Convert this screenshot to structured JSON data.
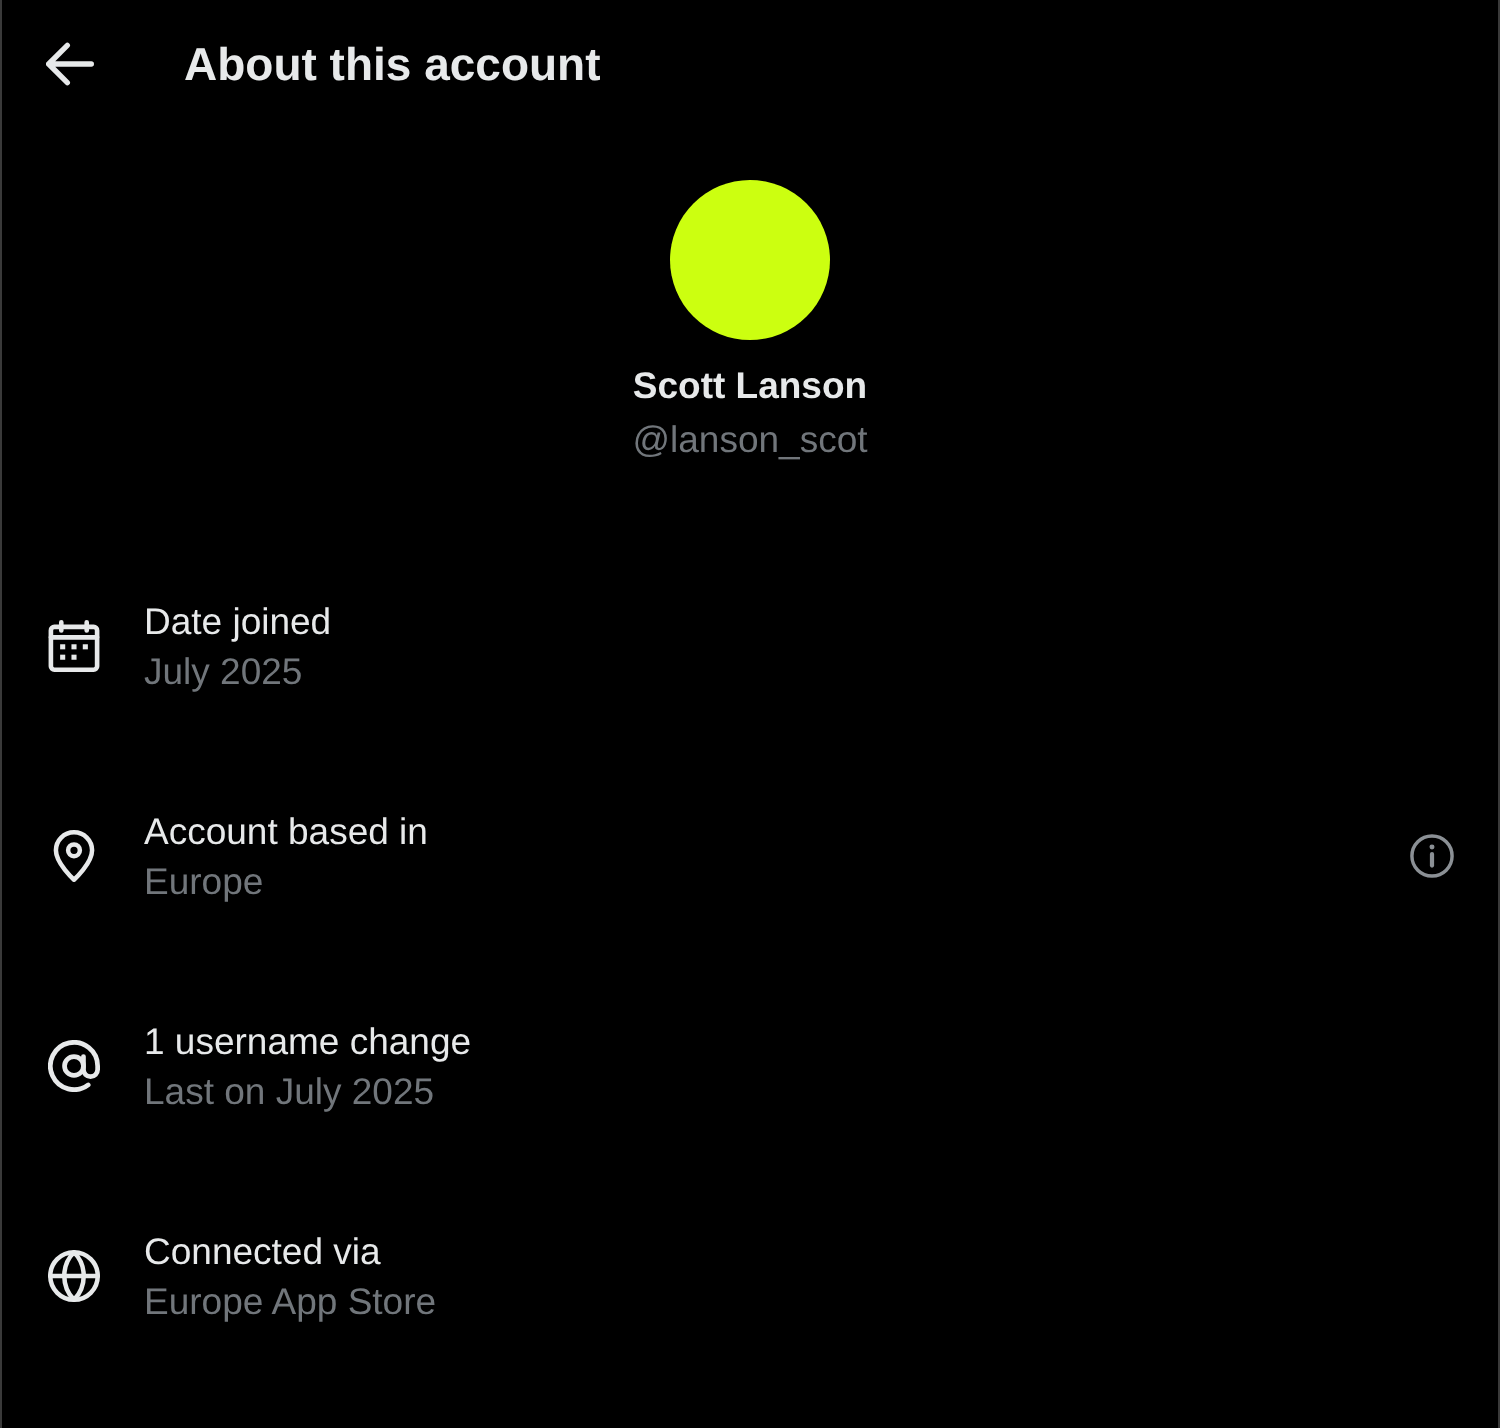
{
  "header": {
    "title": "About this account"
  },
  "profile": {
    "name": "Scott Lanson",
    "handle": "@lanson_scot"
  },
  "details": [
    {
      "kind": "joined",
      "label": "Date joined",
      "value": "July 2025",
      "info_button": false
    },
    {
      "kind": "location",
      "label": "Account based in",
      "value": "Europe",
      "info_button": true
    },
    {
      "kind": "username",
      "label": "1 username change",
      "value": "Last on July 2025",
      "info_button": false
    },
    {
      "kind": "connection",
      "label": "Connected via",
      "value": "Europe App Store",
      "info_button": false
    }
  ]
}
